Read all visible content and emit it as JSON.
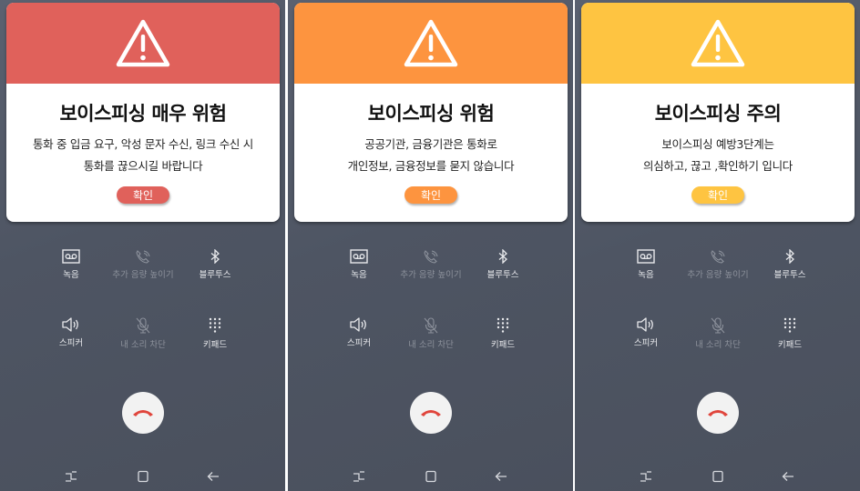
{
  "panels": [
    {
      "color": "#e0615b",
      "title": "보이스피싱 매우 위험",
      "lines": [
        "통화 중 입금 요구, 악성 문자 수신, 링크 수신 시",
        "통화를 끊으시길 바랍니다"
      ],
      "button": "확인"
    },
    {
      "color": "#fd943f",
      "title": "보이스피싱 위험",
      "lines": [
        "공공기관,  금융기관은 통화로",
        "개인정보, 금융정보를 묻지 않습니다"
      ],
      "button": "확인"
    },
    {
      "color": "#fec441",
      "title": "보이스피싱 주의",
      "lines": [
        "보이스피싱 예방3단계는",
        "의심하고, 끊고 ,확인하기 입니다"
      ],
      "button": "확인"
    }
  ],
  "controls": {
    "record": "녹음",
    "extra_volume": "추가 음량 높이기",
    "bluetooth": "블루투스",
    "speaker": "스피커",
    "mute": "내 소리 차단",
    "keypad": "키패드"
  },
  "end_call_color": "#e0453c"
}
